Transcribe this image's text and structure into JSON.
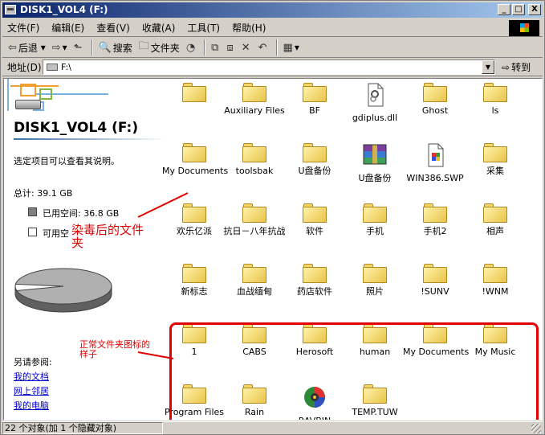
{
  "window": {
    "title": "DISK1_VOL4 (F:)",
    "controls": [
      "_",
      "□",
      "X"
    ]
  },
  "menu": [
    "文件(F)",
    "编辑(E)",
    "查看(V)",
    "收藏(A)",
    "工具(T)",
    "帮助(H)"
  ],
  "toolbar": {
    "back": "后退",
    "search": "搜索",
    "folders": "文件夹"
  },
  "address": {
    "label": "地址(D)",
    "value": "F:\\",
    "go": "转到"
  },
  "leftpane": {
    "drive_title": "DISK1_VOL4 (F:)",
    "prompt": "选定项目可以查看其说明。",
    "total": "总计: 39.1 GB",
    "used": "已用空间: 36.8 GB",
    "free": "可用空",
    "see_also": "另请参阅:",
    "links": [
      "我的文档",
      "网上邻居",
      "我的电脑"
    ],
    "used_fraction": 0.941
  },
  "annotations": {
    "infected": "染毒后的文件夹",
    "infected_line1": "染毒后的文件",
    "infected_line2": "夹",
    "normal_line1": "正常文件夹图标的",
    "normal_line2": "样子",
    "color": "#e00000"
  },
  "items": [
    {
      "label": "",
      "icon": "folder-icon"
    },
    {
      "label": "Auxiliary Files",
      "icon": "folder-icon"
    },
    {
      "label": "BF",
      "icon": "folder-icon"
    },
    {
      "label": "gdiplus.dll",
      "icon": "dll-file-icon"
    },
    {
      "label": "Ghost",
      "icon": "folder-icon"
    },
    {
      "label": "ls",
      "icon": "folder-icon"
    },
    {
      "label": "My Documents",
      "icon": "folder-icon"
    },
    {
      "label": "toolsbak",
      "icon": "folder-icon"
    },
    {
      "label": "U盘备份",
      "icon": "folder-icon"
    },
    {
      "label": "U盘备份",
      "icon": "winrar-archive-icon"
    },
    {
      "label": "WIN386.SWP",
      "icon": "swap-file-icon"
    },
    {
      "label": "采集",
      "icon": "folder-icon"
    },
    {
      "label": "欢乐亿派",
      "icon": "folder-icon"
    },
    {
      "label": "抗日－八年抗战",
      "icon": "folder-icon"
    },
    {
      "label": "软件",
      "icon": "folder-icon"
    },
    {
      "label": "手机",
      "icon": "folder-icon"
    },
    {
      "label": "手机2",
      "icon": "folder-icon"
    },
    {
      "label": "相声",
      "icon": "folder-icon"
    },
    {
      "label": "新标志",
      "icon": "folder-icon"
    },
    {
      "label": "血战缅甸",
      "icon": "folder-icon"
    },
    {
      "label": "药店软件",
      "icon": "folder-icon"
    },
    {
      "label": "照片",
      "icon": "folder-icon"
    },
    {
      "label": "!SUNV",
      "icon": "folder-icon"
    },
    {
      "label": "!WNM",
      "icon": "folder-icon"
    },
    {
      "label": "1",
      "icon": "folder-icon"
    },
    {
      "label": "CABS",
      "icon": "folder-icon"
    },
    {
      "label": "Herosoft",
      "icon": "folder-icon"
    },
    {
      "label": "human",
      "icon": "folder-icon"
    },
    {
      "label": "My Documents",
      "icon": "folder-icon"
    },
    {
      "label": "My Music",
      "icon": "folder-icon"
    },
    {
      "label": "Program Files",
      "icon": "folder-icon"
    },
    {
      "label": "Rain",
      "icon": "folder-icon"
    },
    {
      "label": "RAVBIN",
      "icon": "ravbin-app-icon"
    },
    {
      "label": "TEMP.TUW",
      "icon": "folder-icon"
    }
  ],
  "status": "22 个对象(加 1 个隐藏对象)"
}
